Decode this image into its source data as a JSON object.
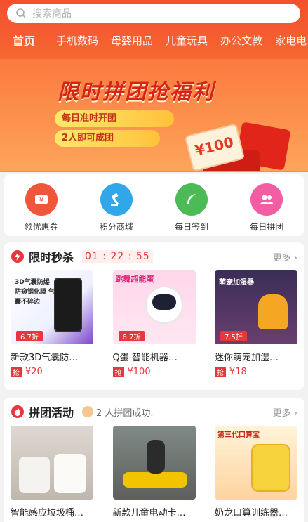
{
  "search": {
    "placeholder": "搜索商品"
  },
  "tabs": [
    "首页",
    "手机数码",
    "母婴用品",
    "儿童玩具",
    "办公文教",
    "家电电"
  ],
  "banner": {
    "title": "限时拼团抢福利",
    "line1": "每日准时开团",
    "line2": "2人即可成团",
    "coupon": "¥100"
  },
  "quick": [
    {
      "label": "领优惠券",
      "icon": "coupon-icon",
      "color": "#f0573a"
    },
    {
      "label": "积分商城",
      "icon": "gavel-icon",
      "color": "#2fa7e8"
    },
    {
      "label": "每日签到",
      "icon": "feather-icon",
      "color": "#4cbb55"
    },
    {
      "label": "每日拼团",
      "icon": "group-icon",
      "color": "#f25da3"
    }
  ],
  "flash": {
    "title": "限时秒杀",
    "timer": "01 : 22 : 55",
    "more": "更多",
    "goods": [
      {
        "name": "新款3D气囊防…",
        "price": "¥20",
        "discount": "6.7折",
        "tag": "抢",
        "img_text": "3D气囊防爆 防窥钢化膜 气囊不碎边"
      },
      {
        "name": "Q蛋 智能机器…",
        "price": "¥100",
        "discount": "6.7折",
        "tag": "抢",
        "img_text": "跳舞超能蛋"
      },
      {
        "name": "迷你萌宠加湿…",
        "price": "¥18",
        "discount": "7.5折",
        "tag": "抢",
        "img_text": "萌宠加湿器"
      }
    ]
  },
  "group": {
    "title": "拼团活动",
    "success": "2 人拼团成功.",
    "more": "更多",
    "goods": [
      {
        "name": "智能感应垃圾桶…"
      },
      {
        "name": "新款儿童电动卡…"
      },
      {
        "name": "奶龙口算训练器…",
        "img_text": "第三代口算宝"
      }
    ]
  }
}
